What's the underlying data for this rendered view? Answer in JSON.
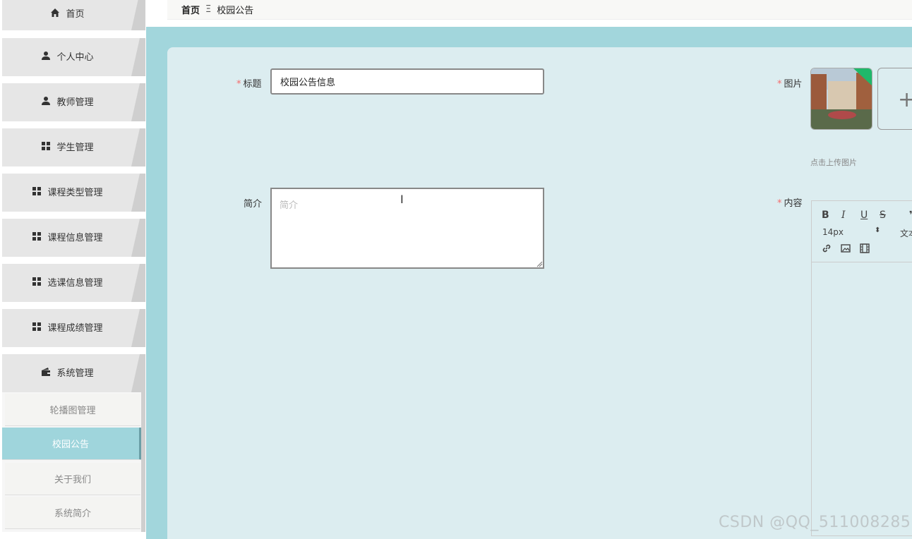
{
  "sidebar": {
    "items": [
      {
        "label": "首页",
        "icon": "home-icon"
      },
      {
        "label": "个人中心",
        "icon": "user-icon"
      },
      {
        "label": "教师管理",
        "icon": "user-icon"
      },
      {
        "label": "学生管理",
        "icon": "grid-icon"
      },
      {
        "label": "课程类型管理",
        "icon": "grid-icon"
      },
      {
        "label": "课程信息管理",
        "icon": "grid-icon"
      },
      {
        "label": "选课信息管理",
        "icon": "grid-icon"
      },
      {
        "label": "课程成绩管理",
        "icon": "grid-icon"
      },
      {
        "label": "系统管理",
        "icon": "wallet-icon"
      }
    ],
    "subitems": [
      {
        "label": "轮播图管理"
      },
      {
        "label": "校园公告"
      },
      {
        "label": "关于我们"
      },
      {
        "label": "系统简介"
      }
    ],
    "active_subitem": "校园公告"
  },
  "breadcrumb": {
    "home": "首页",
    "separator": "Ξ",
    "current": "校园公告"
  },
  "form": {
    "title_label": "标题",
    "title_value": "校园公告信息",
    "image_label": "图片",
    "upload_hint": "点击上传图片",
    "intro_label": "简介",
    "intro_placeholder": "简介",
    "content_label": "内容",
    "required_mark": "*"
  },
  "editor": {
    "bold": "B",
    "italic": "I",
    "underline": "U",
    "strike": "S",
    "font_size": "14px",
    "text_type": "文本"
  },
  "watermark": "CSDN @QQ_511008285",
  "colors": {
    "accent": "#9fd5dc",
    "panel": "#dcedf0",
    "required": "#f56c6c"
  }
}
